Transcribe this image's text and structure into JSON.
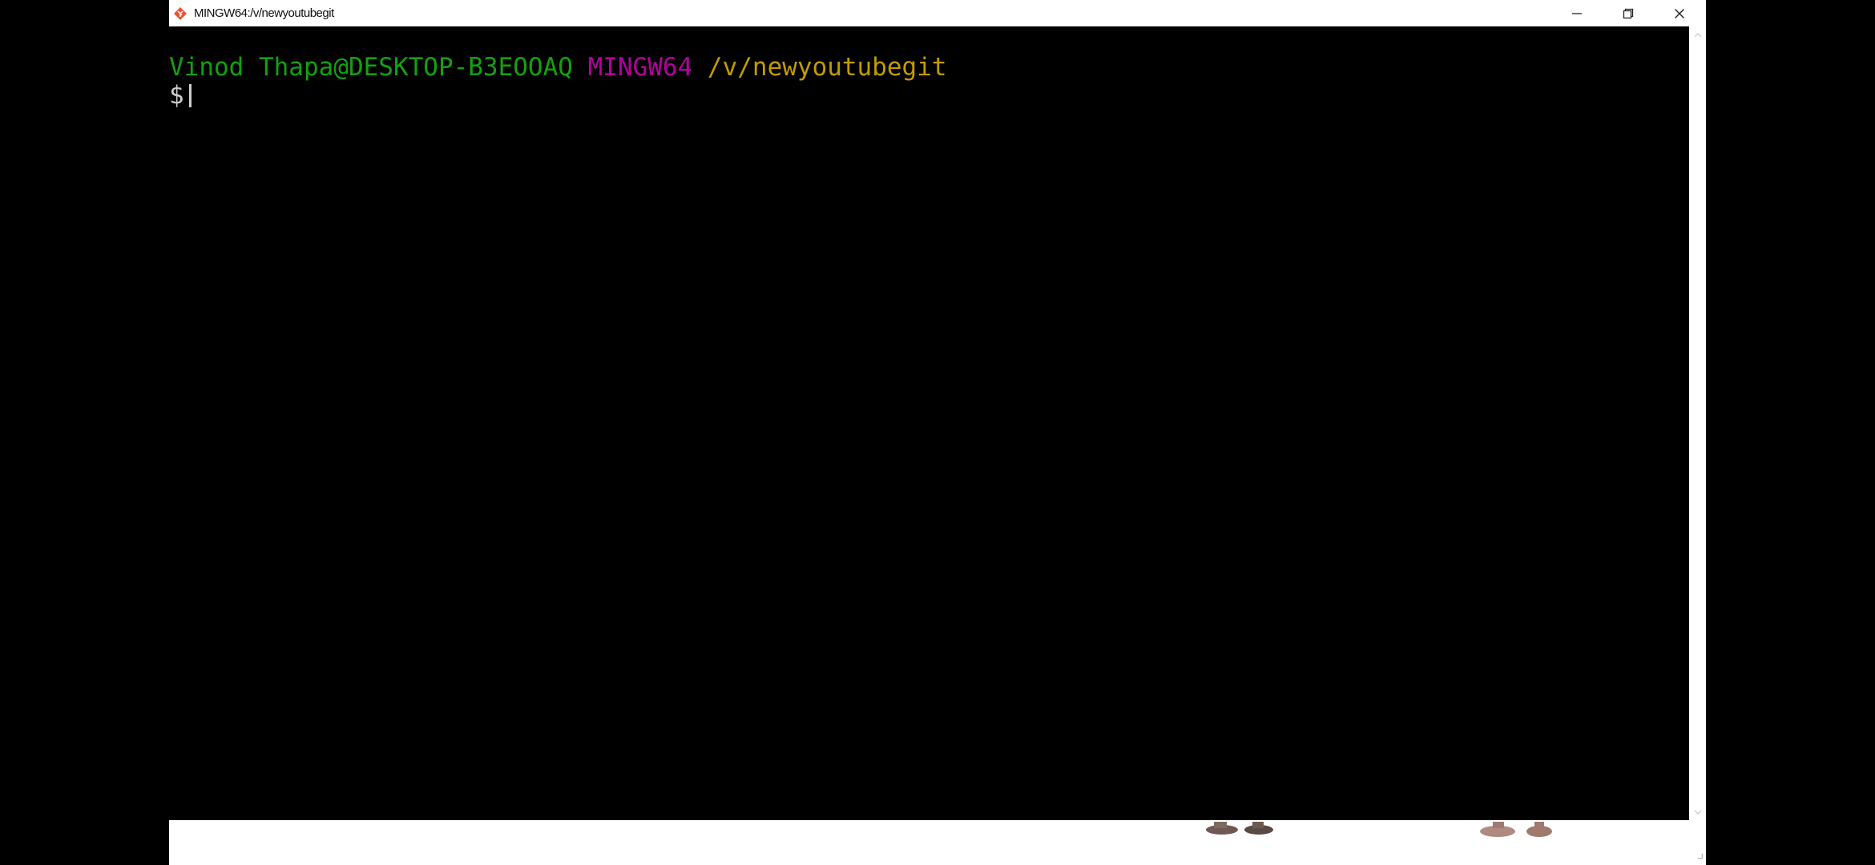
{
  "window": {
    "title": "MINGW64:/v/newyoutubegit"
  },
  "terminal": {
    "prompt": {
      "user_host": "Vinod Thapa@DESKTOP-B3EOOAQ",
      "system": "MINGW64",
      "path": "/v/newyoutubegit",
      "symbol": "$"
    },
    "colors": {
      "background": "#000000",
      "user_host": "#13a10e",
      "system": "#b4009e",
      "path": "#c19c00",
      "text": "#cccccc"
    }
  },
  "icons": {
    "app": "git-bash-icon",
    "minimize": "minimize-icon",
    "restore": "restore-icon",
    "close": "close-icon"
  }
}
